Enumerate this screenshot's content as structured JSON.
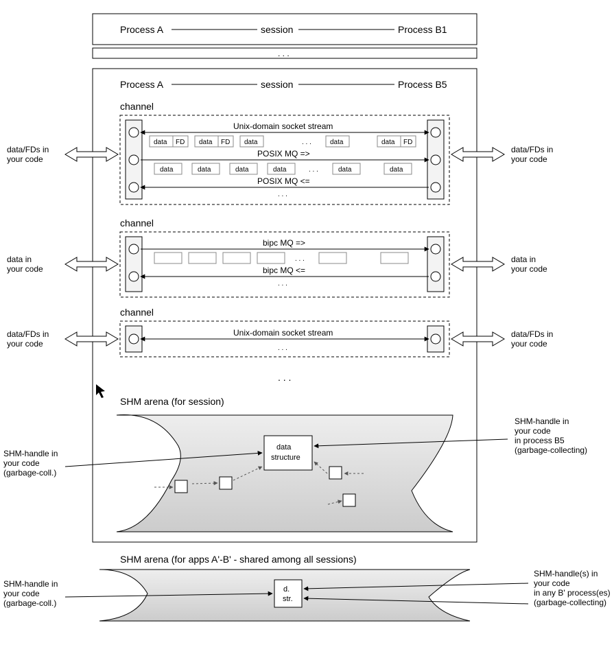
{
  "top": {
    "left": "Process A",
    "mid": "session",
    "right": "Process B1",
    "dots": ". . ."
  },
  "main": {
    "left": "Process A",
    "mid": "session",
    "right": "Process B5",
    "ch1": {
      "label": "channel",
      "l1": "Unix-domain socket stream",
      "l2": "POSIX MQ =>",
      "l3": "POSIX MQ <=",
      "data": "data",
      "fd": "FD",
      "dots": ". . ."
    },
    "ch2": {
      "label": "channel",
      "l1": "bipc MQ =>",
      "l2": "bipc MQ <=",
      "dots": ". . ."
    },
    "ch3": {
      "label": "channel",
      "l1": "Unix-domain socket stream",
      "dots": ". . ."
    },
    "dots": ". . ."
  },
  "arena1": {
    "title": "SHM arena (for session)",
    "ds": "data\nstructure"
  },
  "arena2": {
    "title": "SHM arena (for apps A'-B' - shared among all sessions)",
    "ds": "d.\nstr."
  },
  "ext": {
    "dfd1": "data/FDs in",
    "dfd2": "your code",
    "d1": "data in",
    "d2": "your code",
    "sh1": "SHM-handle in",
    "sh2": "your code",
    "sh3": "(garbage-coll.)",
    "shr1": "SHM-handle in",
    "shr2": "your code",
    "shr3": "in process B5",
    "shr4": "(garbage-collecting)",
    "shr5": "SHM-handle(s) in",
    "shr6": "in any B' process(es)"
  }
}
